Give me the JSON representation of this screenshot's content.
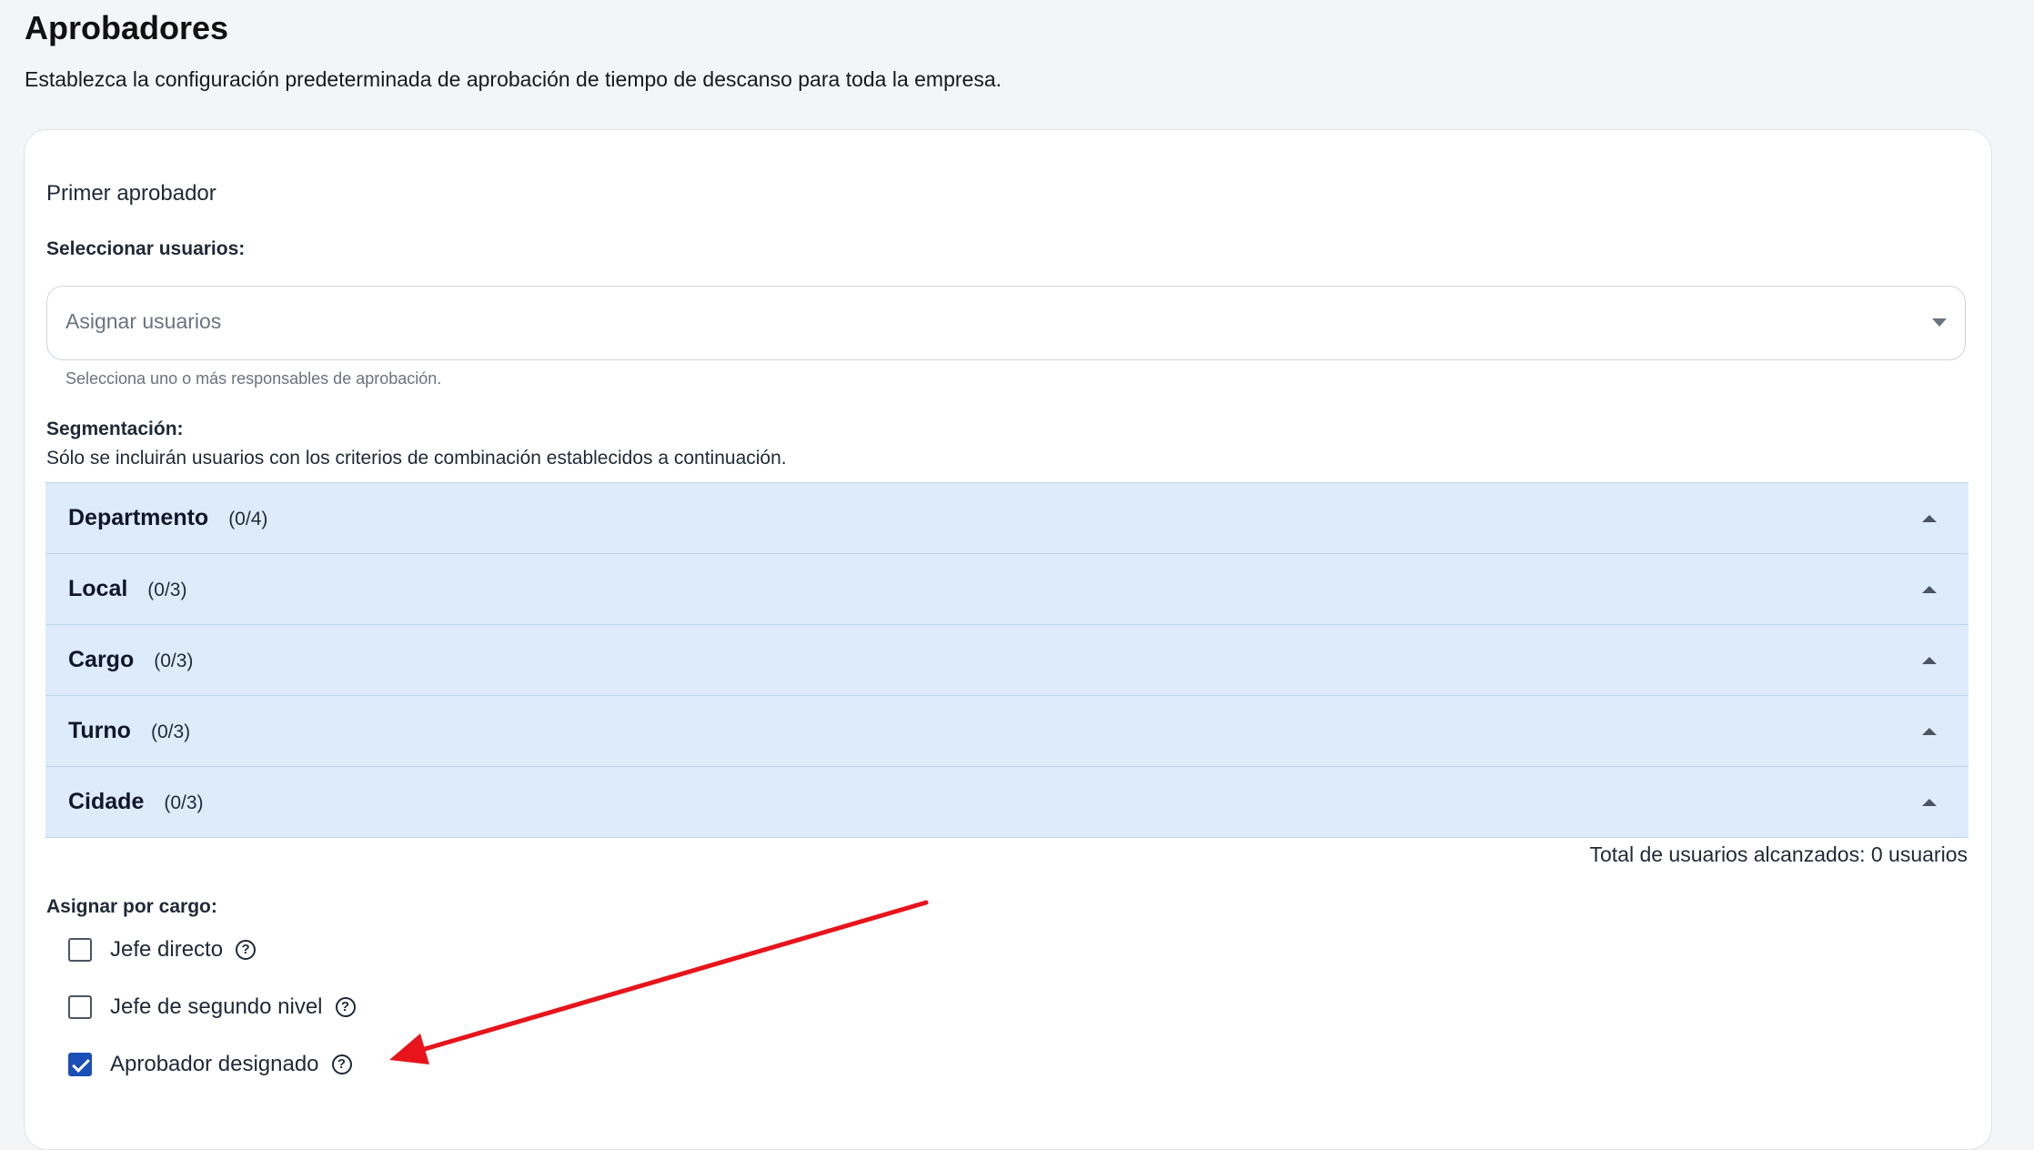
{
  "page": {
    "title": "Aprobadores",
    "subtitle": "Establezca la configuración predeterminada de aprobación de tiempo de descanso para toda la empresa."
  },
  "approver": {
    "section_title": "Primer aprobador",
    "select_users_label": "Seleccionar usuarios:",
    "select_placeholder": "Asignar usuarios",
    "select_helper": "Selecciona uno o más responsables de aprobación."
  },
  "segmentation": {
    "label": "Segmentación:",
    "description": "Sólo se incluirán usuarios con los criterios de combinación establecidos a continuación.",
    "groups": [
      {
        "name": "Departmento",
        "count": "(0/4)"
      },
      {
        "name": "Local",
        "count": "(0/3)"
      },
      {
        "name": "Cargo",
        "count": "(0/3)"
      },
      {
        "name": "Turno",
        "count": "(0/3)"
      },
      {
        "name": "Cidade",
        "count": "(0/3)"
      }
    ],
    "total_text": "Total de usuarios alcanzados: 0 usuarios"
  },
  "assign_by_role": {
    "label": "Asignar por cargo:",
    "options": [
      {
        "label": "Jefe directo",
        "checked": false
      },
      {
        "label": "Jefe de segundo nivel",
        "checked": false
      },
      {
        "label": "Aprobador designado",
        "checked": true
      }
    ],
    "help_glyph": "?"
  },
  "colors": {
    "accordion_bg": "#deebfb",
    "checkbox_checked": "#1a4fb5",
    "annotation_arrow": "#e8141b"
  }
}
